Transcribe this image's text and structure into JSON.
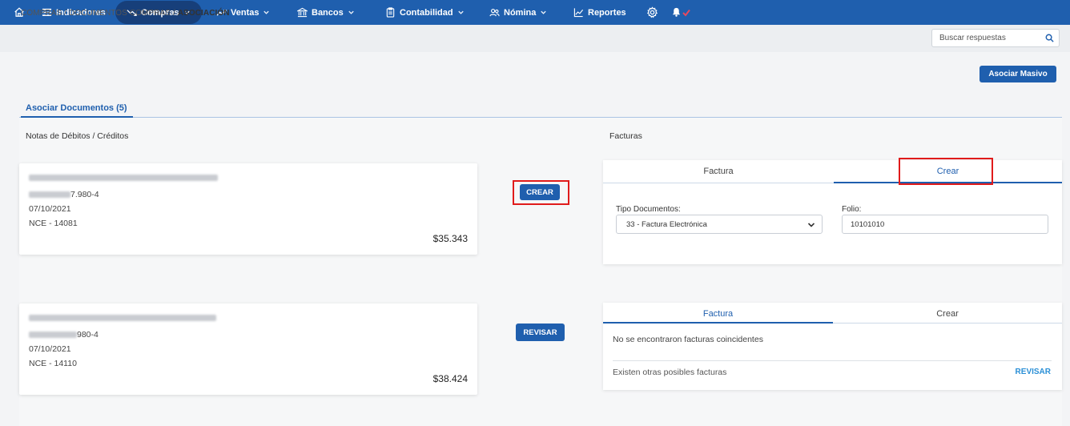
{
  "nav": {
    "items": [
      {
        "label": "Indicadores",
        "icon": "list-icon"
      },
      {
        "label": "Compras",
        "icon": "trend-down-icon"
      },
      {
        "label": "Ventas",
        "icon": "trend-up-icon"
      },
      {
        "label": "Bancos",
        "icon": "bank-icon"
      },
      {
        "label": "Contabilidad",
        "icon": "clipboard-icon"
      },
      {
        "label": "Nómina",
        "icon": "users-icon"
      },
      {
        "label": "Reportes",
        "icon": "chart-line-icon"
      }
    ],
    "brand_color": "#1f5fae",
    "active_color": "#173f7a"
  },
  "breadcrumb": {
    "path": "COMPRAS / DOCUMENTOS COMPRAS /",
    "current": "ASOCIACIÓN"
  },
  "search": {
    "placeholder": "Buscar respuestas"
  },
  "actions": {
    "asociar_masivo": "Asociar Masivo"
  },
  "tab": {
    "label": "Asociar Documentos (5)"
  },
  "left_title": "Notas de Débitos / Créditos",
  "right_title": "Facturas",
  "notes": [
    {
      "id_suffix": "7.980-4",
      "date": "07/10/2021",
      "folio": "NCE - 14081",
      "amount": "$35.343",
      "action": "CREAR"
    },
    {
      "id_suffix": "980-4",
      "date": "07/10/2021",
      "folio": "NCE - 14110",
      "amount": "$38.424",
      "action": "REVISAR"
    }
  ],
  "facturas": [
    {
      "tabs": [
        "Factura",
        "Crear"
      ],
      "active_tab": "Crear",
      "tipo_label": "Tipo Documentos:",
      "tipo_value": "33 - Factura Electrónica",
      "folio_label": "Folio:",
      "folio_value": "10101010"
    },
    {
      "tabs": [
        "Factura",
        "Crear"
      ],
      "active_tab": "Factura",
      "empty_text": "No se encontraron facturas coincidentes",
      "other_text": "Existen otras posibles facturas",
      "revisar_link": "REVISAR"
    }
  ]
}
